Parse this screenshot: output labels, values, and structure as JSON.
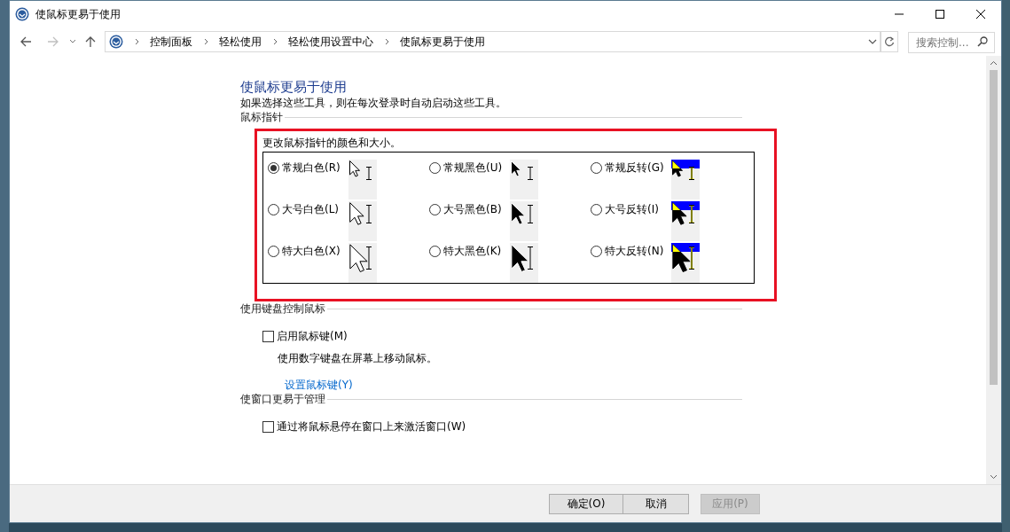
{
  "window": {
    "title": "使鼠标更易于使用"
  },
  "navigation": {
    "back": {
      "disabled": false
    },
    "forward": {
      "disabled": true
    }
  },
  "address_bar": {
    "breadcrumbs": [
      "控制面板",
      "轻松使用",
      "轻松使用设置中心",
      "使鼠标更易于使用"
    ]
  },
  "search": {
    "placeholder": "搜索控制..."
  },
  "page": {
    "heading": "使鼠标更易于使用",
    "subheading": "如果选择这些工具，则在每次登录时自动启动这些工具。"
  },
  "sections": [
    {
      "kind": "pointers",
      "title": "鼠标指针",
      "highlighted": true,
      "description": "更改鼠标指针的颜色和大小。",
      "options": [
        {
          "label": "常规白色(R)",
          "selected": true,
          "kind": "regular_white"
        },
        {
          "label": "常规黑色(U)",
          "selected": false,
          "kind": "regular_black"
        },
        {
          "label": "常规反转(G)",
          "selected": false,
          "kind": "regular_inverted"
        },
        {
          "label": "大号白色(L)",
          "selected": false,
          "kind": "large_white"
        },
        {
          "label": "大号黑色(B)",
          "selected": false,
          "kind": "large_black"
        },
        {
          "label": "大号反转(I)",
          "selected": false,
          "kind": "large_inverted"
        },
        {
          "label": "特大白色(X)",
          "selected": false,
          "kind": "extra_white"
        },
        {
          "label": "特大黑色(K)",
          "selected": false,
          "kind": "extra_black"
        },
        {
          "label": "特大反转(N)",
          "selected": false,
          "kind": "extra_inverted"
        }
      ]
    },
    {
      "kind": "checks",
      "title": "使用键盘控制鼠标",
      "items": [
        {
          "kind": "checkbox",
          "label": "启用鼠标键(M)",
          "checked": false
        },
        {
          "kind": "note",
          "text": "使用数字键盘在屏幕上移动鼠标。"
        },
        {
          "kind": "link",
          "label": "设置鼠标键(Y)"
        }
      ]
    },
    {
      "kind": "checks",
      "title": "使窗口更易于管理",
      "items": [
        {
          "kind": "checkbox",
          "label": "通过将鼠标悬停在窗口上来激活窗口(W)",
          "checked": false
        }
      ]
    }
  ],
  "buttons": [
    {
      "label": "确定(O)",
      "disabled": false
    },
    {
      "label": "取消",
      "disabled": false
    },
    {
      "label": "应用(P)",
      "disabled": true
    }
  ]
}
